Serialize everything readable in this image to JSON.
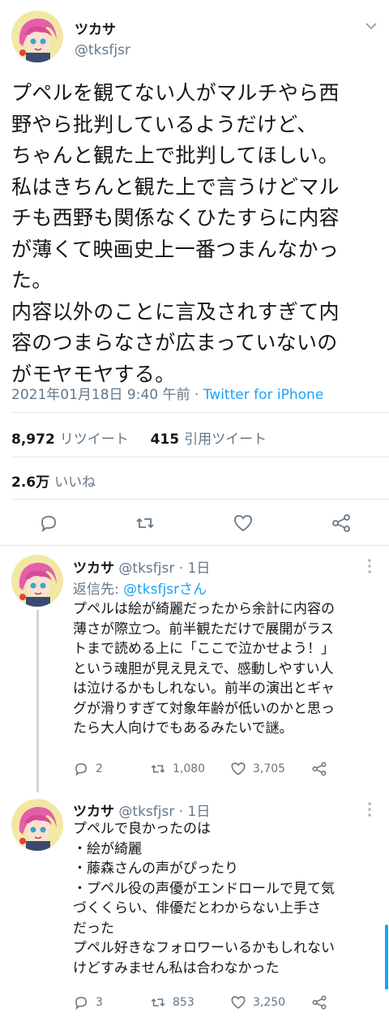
{
  "tweet": {
    "author_name": "ツカサ",
    "author_handle": "@tksfjsr",
    "body": "プペルを観てない人がマルチやら西\n野やら批判しているようだけど、\nちゃんと観た上で批判してほしい。\n私はきちんと観た上で言うけどマル\nチも西野も関係なくひたすらに内容\nが薄くて映画史上一番つまんなかっ\nた。\n内容以外のことに言及されすぎて内\n容のつまらなさが広まっていないの\nがモヤモヤする。",
    "timestamp": "2021年01月18日 9:40 午前",
    "separator": " · ",
    "via": "Twitter for iPhone",
    "retweets_count": "8,972",
    "retweets_label": "リツイート",
    "quotes_count": "415",
    "quotes_label": "引用ツイート",
    "likes_count": "2.6万",
    "likes_label": "いいね"
  },
  "replies": [
    {
      "author_name": "ツカサ",
      "author_handle": "@tksfjsr",
      "age": "· 1日",
      "reply_to_prefix": "返信先: ",
      "reply_to": "@tksfjsrさん",
      "body": "プペルは絵が綺麗だったから余計に内容の\n薄さが際立つ。前半観ただけで展開がラス\nトまで読める上に「ここで泣かせよう！」\nという魂胆が見え見えで、感動しやすい人\nは泣けるかもしれない。前半の演出とギャ\nグが滑りすぎて対象年齢が低いのかと思っ\nたら大人向けでもあるみたいで謎。",
      "reply_count": "2",
      "retweet_count": "1,080",
      "like_count": "3,705"
    },
    {
      "author_name": "ツカサ",
      "author_handle": "@tksfjsr",
      "age": "· 1日",
      "body": "プペルで良かったのは\n・絵が綺麗\n・藤森さんの声がぴったり\n・プペル役の声優がエンドロールで見て気\nづくくらい、俳優だとわからない上手さ\nだった\nプペル好きなフォロワーいるかもしれない\nけどすみません私は合わなかった",
      "reply_count": "3",
      "retweet_count": "853",
      "like_count": "3,250"
    }
  ],
  "colors": {
    "accent": "#1da1f2",
    "secondary_text": "#657786",
    "border": "#e1e8ed"
  },
  "icons": [
    "chevron-down-icon",
    "reply-icon",
    "retweet-icon",
    "like-icon",
    "share-icon",
    "more-icon"
  ]
}
